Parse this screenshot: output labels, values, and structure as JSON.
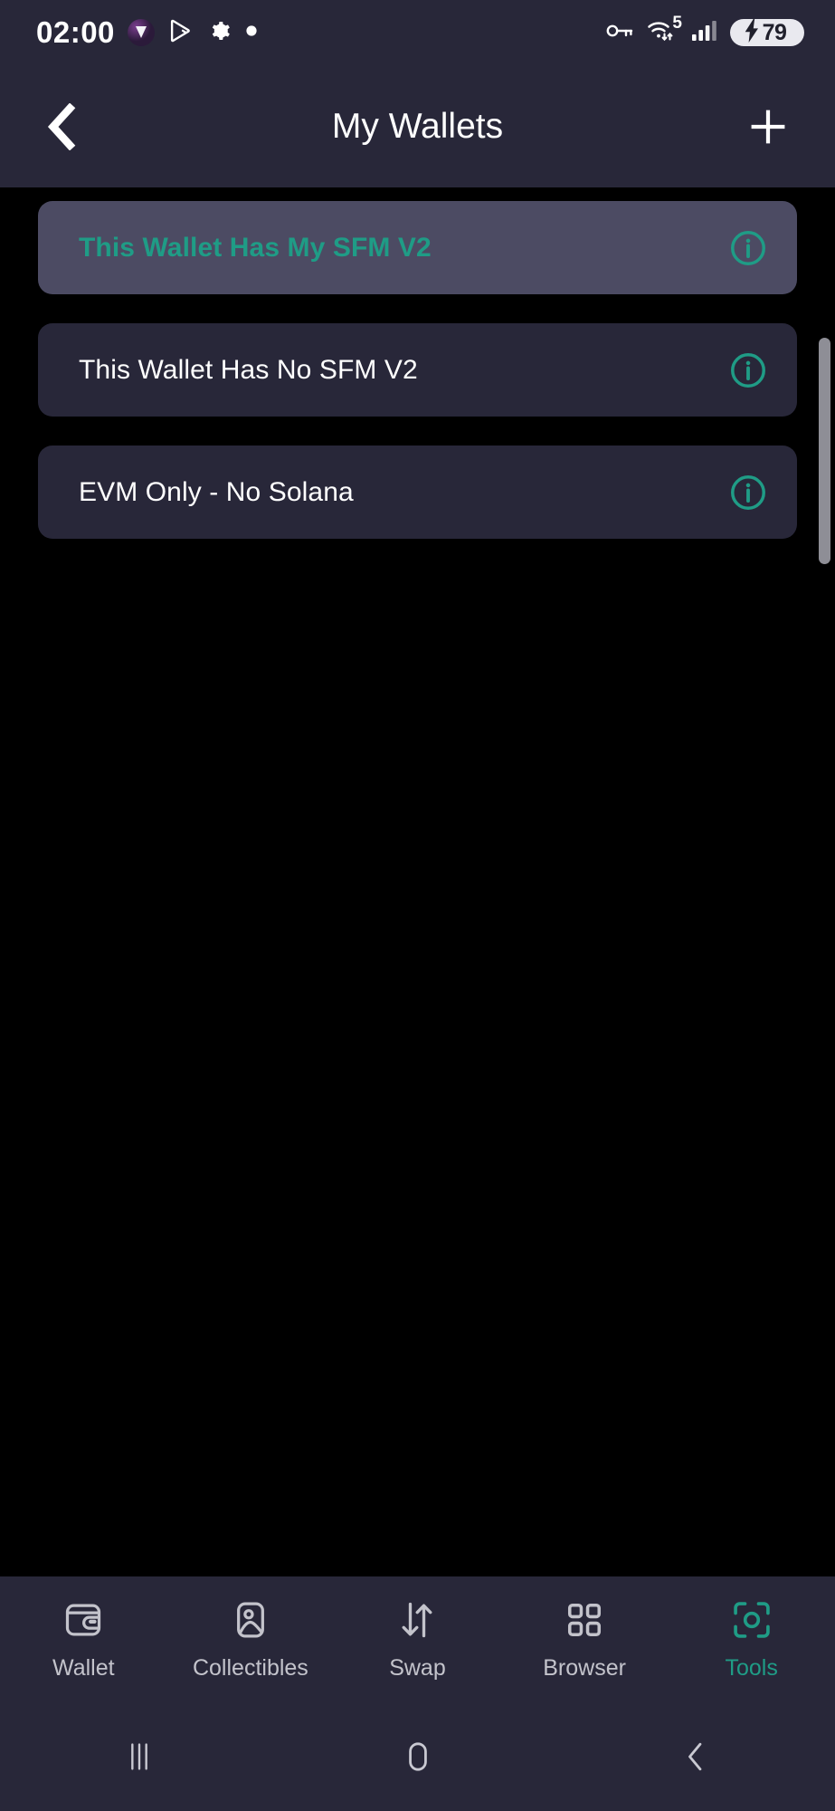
{
  "statusbar": {
    "time": "02:00",
    "left_icons": [
      "app-logo-icon",
      "play-store-icon",
      "gear-icon",
      "dot-indicator-icon"
    ],
    "right_icons": [
      "vpn-key-icon",
      "wifi-icon",
      "cellular-signal-icon"
    ],
    "wifi_badge": "5",
    "battery_level": "79",
    "battery_charging": true
  },
  "header": {
    "title": "My Wallets",
    "back_label": "Back",
    "add_label": "Add wallet"
  },
  "wallets": [
    {
      "name": "This Wallet Has My SFM V2",
      "selected": true,
      "info_label": "Wallet info"
    },
    {
      "name": "This Wallet Has No SFM V2",
      "selected": false,
      "info_label": "Wallet info"
    },
    {
      "name": "EVM Only - No Solana",
      "selected": false,
      "info_label": "Wallet info"
    }
  ],
  "tabbar": {
    "items": [
      {
        "label": "Wallet",
        "icon": "wallet-icon",
        "active": false
      },
      {
        "label": "Collectibles",
        "icon": "image-icon",
        "active": false
      },
      {
        "label": "Swap",
        "icon": "swap-arrows-icon",
        "active": false
      },
      {
        "label": "Browser",
        "icon": "grid-dots-icon",
        "active": false
      },
      {
        "label": "Tools",
        "icon": "scan-focus-icon",
        "active": true
      }
    ]
  },
  "sysnav": {
    "recents_label": "Recents",
    "home_label": "Home",
    "back_label": "Back"
  },
  "colors": {
    "accent": "#1f9c86",
    "chrome": "#282739",
    "card": "#282739",
    "card_selected": "#4c4b63",
    "body_bg": "#000000",
    "text": "#ffffff",
    "tab_inactive": "#c3c3cb"
  }
}
